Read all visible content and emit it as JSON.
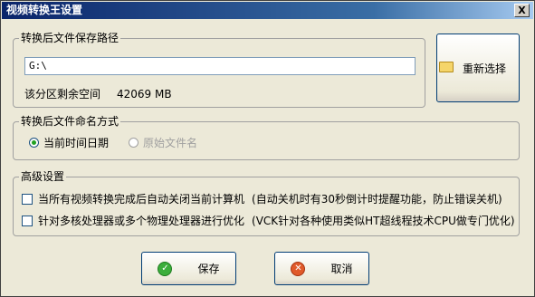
{
  "window": {
    "title": "视频转换王设置",
    "close_glyph": "X"
  },
  "save_path": {
    "title": "转换后文件保存路径",
    "path_value": "G:\\",
    "free_space_label": "该分区剩余空间",
    "free_space_value": "42069",
    "free_space_unit": "MB",
    "reselect_label": "重新选择",
    "reselect_icon": "folder-icon"
  },
  "naming": {
    "title": "转换后文件命名方式",
    "options": [
      {
        "label": "当前时间日期",
        "checked": true,
        "enabled": true
      },
      {
        "label": "原始文件名",
        "checked": false,
        "enabled": false
      }
    ]
  },
  "advanced": {
    "title": "高级设置",
    "options": [
      {
        "label": "当所有视频转换完成后自动关闭当前计算机",
        "note": "(自动关机时有30秒倒计时提醒功能，防止错误关机)",
        "checked": false
      },
      {
        "label": "针对多核处理器或多个物理处理器进行优化",
        "note": "(VCK针对各种使用类似HT超线程技术CPU做专门优化)",
        "checked": false
      }
    ]
  },
  "buttons": {
    "save_label": "保存",
    "save_icon": "check-icon",
    "cancel_label": "取消",
    "cancel_icon": "cancel-icon"
  },
  "colors": {
    "title_bar": "#0a246a",
    "save_icon": "#3cae3c",
    "cancel_icon": "#e05a2a"
  }
}
